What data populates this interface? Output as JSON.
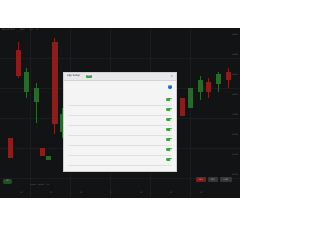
{
  "chart": {
    "top_labels": [
      "Mar 14 2022",
      "LAST",
      "3d",
      "1h",
      "O:",
      "H:",
      "L:",
      "C:"
    ],
    "price_axis": [
      "4,460",
      "4,440",
      "4,420",
      "4,400",
      "4,380",
      "4,360",
      "4,340",
      "4,320"
    ],
    "time_axis": [
      "14",
      "15",
      "16",
      "17",
      "18",
      "21",
      "22"
    ],
    "status": {
      "left_pill": "OK",
      "mid_text": "Lorem · ipsum · 1m",
      "right_buttons": [
        "SELL",
        "BUY",
        "FLAT"
      ]
    },
    "colors": {
      "up": "#43a047",
      "down": "#d32f2f",
      "background": "#1d1e1f"
    }
  },
  "dialog": {
    "title": "App Setup",
    "badge": "NEW",
    "close_icon": "close-icon",
    "info_icon": "info-icon",
    "description": "",
    "settings": [
      {
        "name": "",
        "desc": "",
        "enabled": true
      },
      {
        "name": "",
        "desc": "",
        "enabled": true
      },
      {
        "name": "",
        "desc": "",
        "enabled": true
      },
      {
        "name": "",
        "desc": "",
        "enabled": true
      },
      {
        "name": "",
        "desc": "",
        "enabled": true
      },
      {
        "name": "",
        "desc": "",
        "enabled": true
      },
      {
        "name": "",
        "desc": "",
        "enabled": true
      }
    ]
  }
}
